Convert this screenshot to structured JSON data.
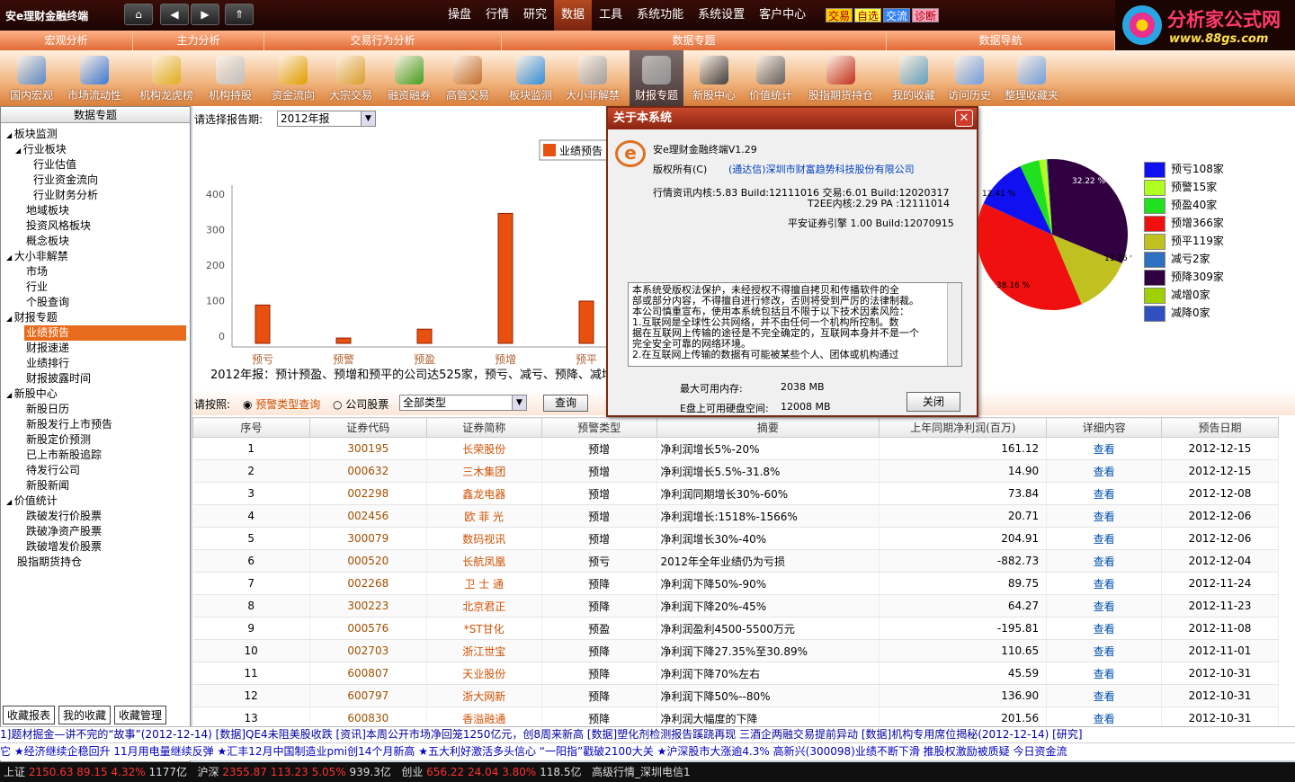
{
  "app": {
    "title": "安e理财金融终端"
  },
  "nav": {
    "home": "⌂",
    "back": "◀",
    "forward": "▶",
    "up": "⇑"
  },
  "topmenu": [
    "操盘",
    "行情",
    "研究",
    "数据",
    "工具",
    "系统功能",
    "系统设置",
    "客户中心"
  ],
  "quick": [
    {
      "label": "交易",
      "bg": "#ffcc00",
      "fg": "#a00000"
    },
    {
      "label": "自选",
      "bg": "#ffff40",
      "fg": "#a00000"
    },
    {
      "label": "交流",
      "bg": "#3080ff",
      "fg": "#ffffff"
    },
    {
      "label": "诊断",
      "bg": "#ffa0c0",
      "fg": "#a00000"
    }
  ],
  "logo": {
    "title": "分析家公式网",
    "url": "www.88gs.com"
  },
  "categories": [
    {
      "label": "宏观分析",
      "w": 148
    },
    {
      "label": "主力分析",
      "w": 146
    },
    {
      "label": "交易行为分析",
      "w": 264
    },
    {
      "label": "数据专题",
      "w": 428
    },
    {
      "label": "数据导航",
      "w": 254
    }
  ],
  "tools": [
    {
      "label": "国内宏观",
      "color": "#5a8ac8"
    },
    {
      "label": "市场流动性",
      "color": "#3a7ad8"
    },
    {
      "label": "机构龙虎榜",
      "color": "#e0b020"
    },
    {
      "label": "机构持股",
      "color": "#c0c0c0"
    },
    {
      "label": "资金流向",
      "color": "#e0a000"
    },
    {
      "label": "大宗交易",
      "color": "#d8a030"
    },
    {
      "label": "融资融券",
      "color": "#40a020"
    },
    {
      "label": "高管交易",
      "color": "#c07030"
    },
    {
      "label": "板块监测",
      "color": "#3090e0"
    },
    {
      "label": "大小非解禁",
      "color": "#a0a0a0"
    },
    {
      "label": "财报专题",
      "color": "#909090"
    },
    {
      "label": "新股中心",
      "color": "#404040"
    },
    {
      "label": "价值统计",
      "color": "#606060"
    },
    {
      "label": "股指期货持仓",
      "color": "#c03020"
    },
    {
      "label": "我的收藏",
      "color": "#60a0c0"
    },
    {
      "label": "访问历史",
      "color": "#70a0e0"
    },
    {
      "label": "整理收藏夹",
      "color": "#70a0e0"
    }
  ],
  "leftpanel": {
    "title": "数据专题",
    "tree": [
      {
        "t": "板块监测",
        "lv": 0,
        "exp": true
      },
      {
        "t": "行业板块",
        "lv": 1,
        "exp": true
      },
      {
        "t": "行业估值",
        "lv": 2
      },
      {
        "t": "行业资金流向",
        "lv": 2
      },
      {
        "t": "行业财务分析",
        "lv": 2
      },
      {
        "t": "地域板块",
        "lv": 1
      },
      {
        "t": "投资风格板块",
        "lv": 1
      },
      {
        "t": "概念板块",
        "lv": 1
      },
      {
        "t": "大小非解禁",
        "lv": 0,
        "exp": true
      },
      {
        "t": "市场",
        "lv": 1
      },
      {
        "t": "行业",
        "lv": 1
      },
      {
        "t": "个股查询",
        "lv": 1
      },
      {
        "t": "财报专题",
        "lv": 0,
        "exp": true
      },
      {
        "t": "业绩预告",
        "lv": 1,
        "sel": true
      },
      {
        "t": "财报速递",
        "lv": 1
      },
      {
        "t": "业绩排行",
        "lv": 1
      },
      {
        "t": "财报披露时间",
        "lv": 1
      },
      {
        "t": "新股中心",
        "lv": 0,
        "exp": true
      },
      {
        "t": "新股日历",
        "lv": 1
      },
      {
        "t": "新股发行上市预告",
        "lv": 1
      },
      {
        "t": "新股定价预测",
        "lv": 1
      },
      {
        "t": "已上市新股追踪",
        "lv": 1
      },
      {
        "t": "待发行公司",
        "lv": 1
      },
      {
        "t": "新股新闻",
        "lv": 1
      },
      {
        "t": "价值统计",
        "lv": 0,
        "exp": true
      },
      {
        "t": "跌破发行价股票",
        "lv": 1
      },
      {
        "t": "跌破净资产股票",
        "lv": 1
      },
      {
        "t": "跌破增发价股票",
        "lv": 1
      },
      {
        "t": "股指期货持仓",
        "lv": 0
      }
    ],
    "bottom": [
      "收藏报表",
      "我的收藏",
      "收藏管理"
    ]
  },
  "period": {
    "label": "请选择报告期:",
    "value": "2012年报"
  },
  "chart_data": {
    "type": "bar",
    "legend": "业绩预告",
    "categories": [
      "预亏",
      "预警",
      "预盈",
      "预增",
      "预平"
    ],
    "values": [
      108,
      15,
      40,
      366,
      119
    ],
    "ylim": [
      0,
      400
    ],
    "yticks": [
      0,
      100,
      200,
      300,
      400
    ]
  },
  "summary": "2012年报：预计预盈、预增和预平的公司达525家，预亏、减亏、预降、减增",
  "pie": {
    "slices": [
      {
        "name": "预亏",
        "value": 108,
        "color": "#1010f0"
      },
      {
        "name": "预警",
        "value": 15,
        "color": "#b0ff20"
      },
      {
        "name": "预盈",
        "value": 40,
        "color": "#20e020"
      },
      {
        "name": "预增",
        "value": 366,
        "color": "#f01010"
      },
      {
        "name": "预平",
        "value": 119,
        "color": "#c0c020"
      },
      {
        "name": "减亏",
        "value": 2,
        "color": "#3070c0"
      },
      {
        "name": "预降",
        "value": 309,
        "color": "#300040"
      },
      {
        "name": "减增",
        "value": 0,
        "color": "#a0d000"
      },
      {
        "name": "减降",
        "value": 0,
        "color": "#3050c0"
      }
    ],
    "labels": [
      "32.22 %",
      "12.41 %",
      "38.16 %",
      "11.26 %"
    ],
    "legend": [
      "预亏108家",
      "预警15家",
      "预盈40家",
      "预增366家",
      "预平119家",
      "减亏2家",
      "预降309家",
      "减增0家",
      "减降0家"
    ]
  },
  "query": {
    "label": "请按照:",
    "opt1": "预警类型查询",
    "opt2": "公司股票",
    "type": "全部类型",
    "btn": "查询"
  },
  "table": {
    "headers": [
      "序号",
      "证券代码",
      "证券简称",
      "预警类型",
      "摘要",
      "上年同期净利润(百万)",
      "详细内容",
      "预告日期"
    ],
    "rows": [
      [
        "1",
        "300195",
        "长荣股份",
        "预增",
        "净利润增长5%-20%",
        "161.12",
        "查看",
        "2012-12-15"
      ],
      [
        "2",
        "000632",
        "三木集团",
        "预增",
        "净利润增长5.5%-31.8%",
        "14.90",
        "查看",
        "2012-12-15"
      ],
      [
        "3",
        "002298",
        "鑫龙电器",
        "预增",
        "净利润同期增长30%-60%",
        "73.84",
        "查看",
        "2012-12-08"
      ],
      [
        "4",
        "002456",
        "欧 菲 光",
        "预增",
        "净利润增长:1518%-1566%",
        "20.71",
        "查看",
        "2012-12-06"
      ],
      [
        "5",
        "300079",
        "数码视讯",
        "预增",
        "净利润增长30%-40%",
        "204.91",
        "查看",
        "2012-12-06"
      ],
      [
        "6",
        "000520",
        "长航凤凰",
        "预亏",
        "2012年全年业绩仍为亏损",
        "-882.73",
        "查看",
        "2012-12-04"
      ],
      [
        "7",
        "002268",
        "卫 士 通",
        "预降",
        "净利润下降50%-90%",
        "89.75",
        "查看",
        "2012-11-24"
      ],
      [
        "8",
        "300223",
        "北京君正",
        "预降",
        "净利润下降20%-45%",
        "64.27",
        "查看",
        "2012-11-23"
      ],
      [
        "9",
        "000576",
        "*ST甘化",
        "预盈",
        "净利润盈利4500-5500万元",
        "-195.81",
        "查看",
        "2012-11-08"
      ],
      [
        "10",
        "002703",
        "浙江世宝",
        "预降",
        "净利润下降27.35%至30.89%",
        "110.65",
        "查看",
        "2012-11-01"
      ],
      [
        "11",
        "600807",
        "天业股份",
        "预降",
        "净利润下降70%左右",
        "45.59",
        "查看",
        "2012-10-31"
      ],
      [
        "12",
        "600797",
        "浙大网新",
        "预降",
        "净利润下降50%--80%",
        "136.90",
        "查看",
        "2012-10-31"
      ],
      [
        "13",
        "600830",
        "香溢融通",
        "预降",
        "净利润大幅度的下降",
        "201.56",
        "查看",
        "2012-10-31"
      ]
    ]
  },
  "dialog": {
    "title": "关于本系统",
    "line1": "安e理财金融终端V1.29",
    "line2a": "版权所有(C)",
    "line2b": "(通达信)深圳市财富趋势科技股份有限公司",
    "line3": "行情资讯内核:5.83 Build:12111016 交易:6.01 Build:12020317",
    "line4": "T2EE内核:2.29 PA   :12111014",
    "line5": "平安证券引擎 1.00 Build:12070915",
    "box": [
      "    本系统受版权法保护，未经授权不得擅自拷贝和传播软件的全",
      "部或部分内容，不得擅自进行修改，否则将受到严厉的法律制裁。",
      "本公司慎重宣布，使用本系统包括且不限于以下技术因素风险：",
      "   1.互联网是全球性公共网络，并不由任何一个机构所控制。数",
      "据在互联网上传输的途径是不完全确定的，互联网本身并不是一个",
      "完全安全可靠的网络环境。",
      "   2.在互联网上传输的数据有可能被某些个人、团体或机构通过"
    ],
    "mem_label": "最大可用内存:",
    "mem_val": "2038 MB",
    "disk_label": "E盘上可用硬盘空间:",
    "disk_val": "12008 MB",
    "close": "关闭"
  },
  "ticker1": "1]题材掘金—讲不完的“故事”(2012-12-14)    [数据]QE4未阻美股收跌    [资讯]本周公开市场净回笼1250亿元，创8周来新高    [数据]塑化剂检测报告蹊跷再现 三酒企两融交易提前异动    [数据]机构专用席位揭秘(2012-12-14)    [研究]",
  "ticker2": "它    ★经济继续企稳回升    11月用电量继续反弹    ★汇丰12月中国制造业pmi创14个月新高    ★五大利好激活多头信心 “一阳指”戳破2100大关    ★沪深股市大涨逾4.3%    高新兴(300098)业绩不断下滑 推股权激励被质疑    今日资金流",
  "status": {
    "sh": "上证",
    "sh_v": "2150.63",
    "sh_c": "89.15",
    "sh_p": "4.32%",
    "sh_a": "1177亿",
    "sz": "沪深",
    "sz_v": "2355.87",
    "sz_c": "113.23",
    "sz_p": "5.05%",
    "sz_a": "939.3亿",
    "cy": "创业",
    "cy_v": "656.22",
    "cy_c": "24.04",
    "cy_p": "3.80%",
    "cy_a": "118.5亿",
    "net": "高级行情_深圳电信1"
  }
}
